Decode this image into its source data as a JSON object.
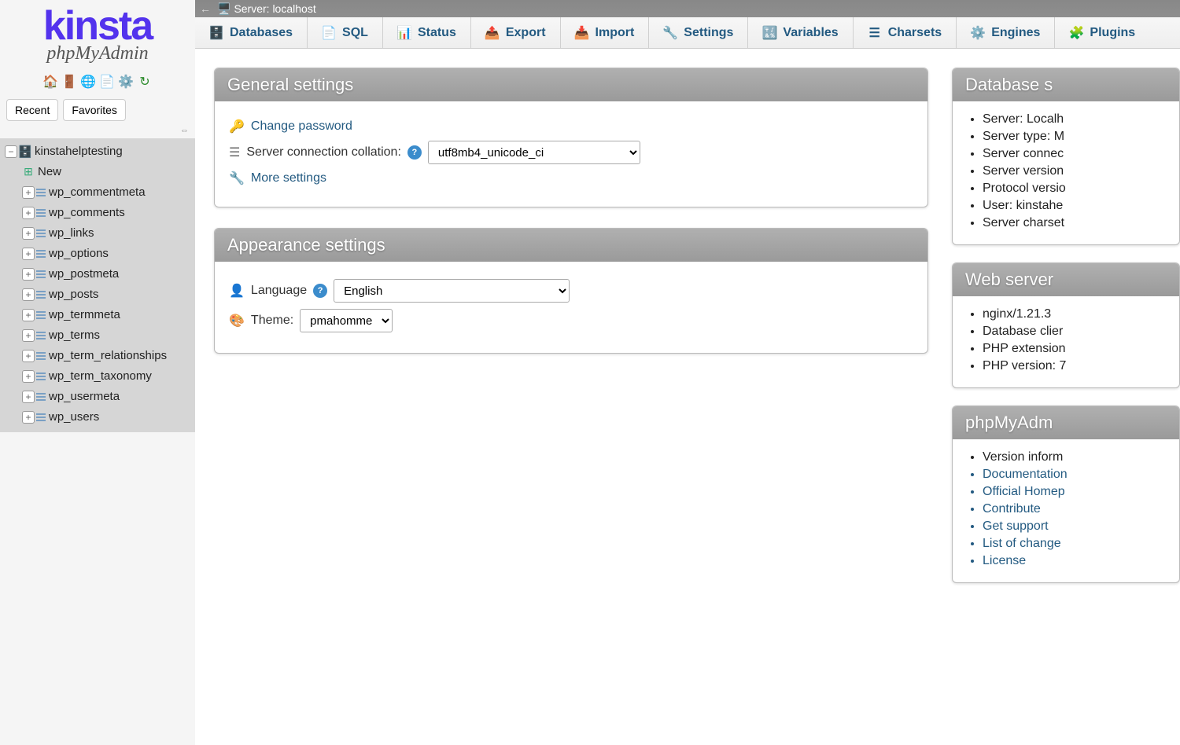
{
  "logo": {
    "main": "kinsta",
    "sub": "phpMyAdmin"
  },
  "sidebar_tabs": {
    "recent": "Recent",
    "favorites": "Favorites"
  },
  "tree": {
    "database": "kinstahelptesting",
    "new_label": "New",
    "tables": [
      "wp_commentmeta",
      "wp_comments",
      "wp_links",
      "wp_options",
      "wp_postmeta",
      "wp_posts",
      "wp_termmeta",
      "wp_terms",
      "wp_term_relationships",
      "wp_term_taxonomy",
      "wp_usermeta",
      "wp_users"
    ]
  },
  "serverbar": {
    "label": "Server: localhost"
  },
  "tabs": [
    {
      "label": "Databases",
      "icon": "🗄️"
    },
    {
      "label": "SQL",
      "icon": "📄"
    },
    {
      "label": "Status",
      "icon": "📊"
    },
    {
      "label": "Export",
      "icon": "📤"
    },
    {
      "label": "Import",
      "icon": "📥"
    },
    {
      "label": "Settings",
      "icon": "🔧"
    },
    {
      "label": "Variables",
      "icon": "🔣"
    },
    {
      "label": "Charsets",
      "icon": "☰"
    },
    {
      "label": "Engines",
      "icon": "⚙️"
    },
    {
      "label": "Plugins",
      "icon": "🧩"
    }
  ],
  "general": {
    "title": "General settings",
    "change_password": "Change password",
    "collation_label": "Server connection collation:",
    "collation_value": "utf8mb4_unicode_ci",
    "more_settings": "More settings"
  },
  "appearance": {
    "title": "Appearance settings",
    "language_label": "Language",
    "language_value": "English",
    "theme_label": "Theme:",
    "theme_value": "pmahomme"
  },
  "db_server": {
    "title": "Database s",
    "items": [
      "Server: Localh",
      "Server type: M",
      "Server connec",
      "Server version",
      "Protocol versio",
      "User: kinstahe",
      "Server charset"
    ]
  },
  "web_server": {
    "title": "Web server",
    "items": [
      "nginx/1.21.3",
      "Database clier",
      "PHP extension",
      "PHP version: 7"
    ]
  },
  "pma": {
    "title": "phpMyAdm",
    "items": [
      "Version inform",
      "Documentation",
      "Official Homep",
      "Contribute",
      "Get support",
      "List of change",
      "License"
    ]
  }
}
